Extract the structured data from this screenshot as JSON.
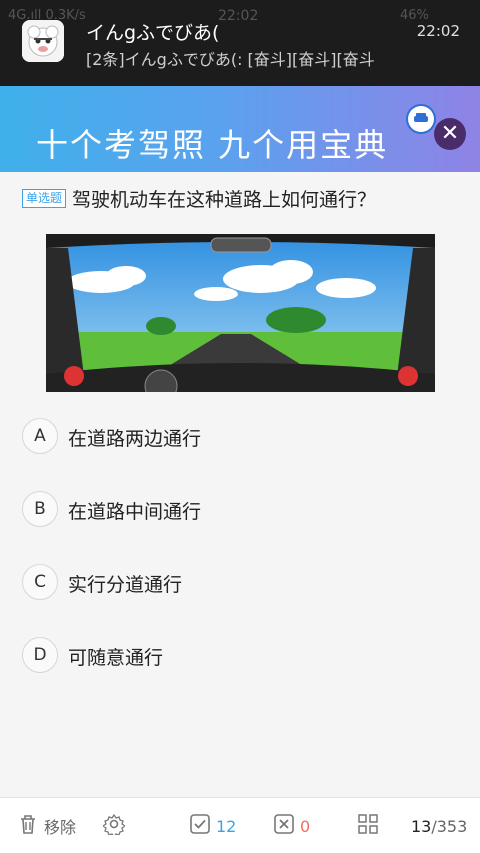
{
  "status_bar": {
    "left": "4G.ıll 0.3K/s",
    "time": "22:02",
    "battery": "46%"
  },
  "notification": {
    "title": "イんgふでびあ(",
    "message": "[2条]イんgふでびあ(: [奋斗][奋斗][奋斗",
    "time": "22:02"
  },
  "banner": {
    "slogan": "十个考驾照 九个用宝典",
    "close_symbol": "✕"
  },
  "question": {
    "type_tag": "单选题",
    "text": "驾驶机动车在这种道路上如何通行？"
  },
  "options": [
    {
      "letter": "A",
      "text": "在道路两边通行"
    },
    {
      "letter": "B",
      "text": "在道路中间通行"
    },
    {
      "letter": "C",
      "text": "实行分道通行"
    },
    {
      "letter": "D",
      "text": "可随意通行"
    }
  ],
  "bottom_bar": {
    "remove_label": "移除",
    "correct_count": "12",
    "wrong_count": "0",
    "current_page": "13",
    "total_pages": "/353"
  },
  "colors": {
    "accent": "#3ba3e8",
    "wrong": "#f26d5b",
    "close_button": "#4b2c6b"
  }
}
